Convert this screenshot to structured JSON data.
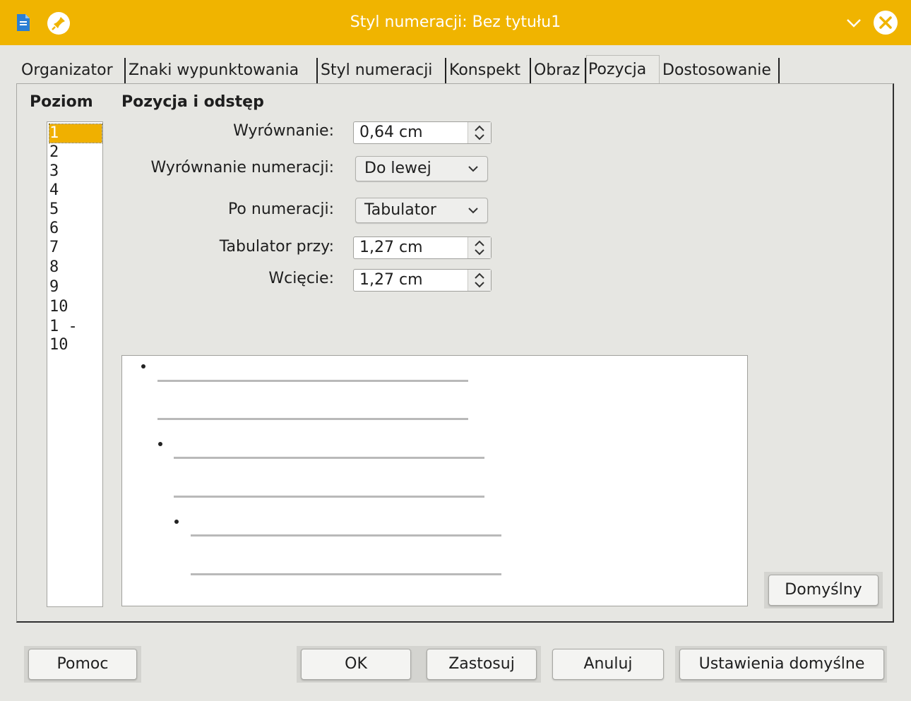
{
  "window": {
    "title": "Styl numeracji: Bez tytułu1"
  },
  "tabs": [
    {
      "label": "Organizator"
    },
    {
      "label": "Znaki wypunktowania"
    },
    {
      "label": "Styl numeracji"
    },
    {
      "label": "Konspekt"
    },
    {
      "label": "Obraz"
    },
    {
      "label": "Pozycja",
      "active": true
    },
    {
      "label": "Dostosowanie"
    }
  ],
  "level": {
    "heading": "Poziom",
    "items": [
      "1",
      "2",
      "3",
      "4",
      "5",
      "6",
      "7",
      "8",
      "9",
      "10",
      "1 - 10"
    ],
    "selected": "1"
  },
  "position": {
    "heading": "Pozycja i odstęp",
    "aligned_at": {
      "label": "Wyrównanie:",
      "value": "0,64 cm"
    },
    "numbering_alignment": {
      "label": "Wyrównanie numeracji:",
      "value": "Do lewej"
    },
    "numbering_followed_by": {
      "label": "Po numeracji:",
      "value": "Tabulator"
    },
    "tab_stop_at": {
      "label": "Tabulator przy:",
      "value": "1,27 cm"
    },
    "indent_at": {
      "label": "Wcięcie:",
      "value": "1,27 cm"
    }
  },
  "buttons": {
    "default": "Domyślny",
    "help": "Pomoc",
    "ok": "OK",
    "apply": "Zastosuj",
    "cancel": "Anuluj",
    "reset": "Ustawienia domyślne"
  },
  "colors": {
    "titlebar": "#f0b400",
    "selection": "#f0b000"
  }
}
